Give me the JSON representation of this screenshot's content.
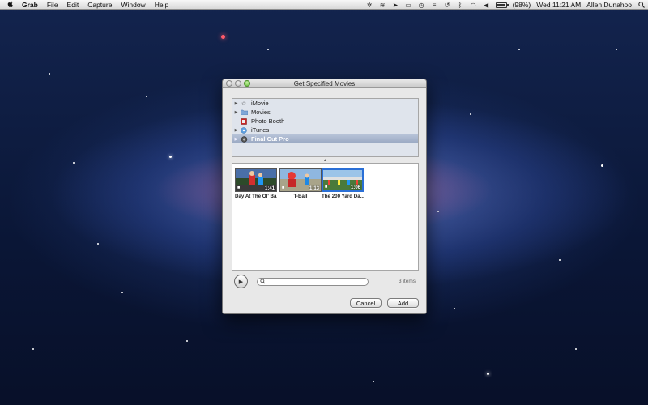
{
  "menubar": {
    "app_name": "Grab",
    "items": [
      "File",
      "Edit",
      "Capture",
      "Window",
      "Help"
    ],
    "battery_text": "(98%)",
    "battery_level": 0.98,
    "datetime": "Wed 11:21 AM",
    "user": "Allen Dunahoo"
  },
  "dialog": {
    "title": "Get Specified Movies",
    "sources": [
      {
        "label": "iMovie",
        "icon": "star-icon",
        "expandable": true
      },
      {
        "label": "Movies",
        "icon": "folder-icon",
        "expandable": true
      },
      {
        "label": "Photo Booth",
        "icon": "photo-booth-icon",
        "expandable": false
      },
      {
        "label": "iTunes",
        "icon": "itunes-icon",
        "expandable": true
      },
      {
        "label": "Final Cut Pro",
        "icon": "final-cut-icon",
        "expandable": true,
        "selected": true
      }
    ],
    "movies": [
      {
        "caption": "Day At The Ol' Ba...",
        "duration": "1:41"
      },
      {
        "caption": "T-Ball",
        "duration": "1:13"
      },
      {
        "caption": "The 200 Yard Da...",
        "duration": "1:06"
      }
    ],
    "search_value": "",
    "item_count": "3 items",
    "cancel_label": "Cancel",
    "add_label": "Add"
  },
  "colors": {
    "selection": "#2a6fd6",
    "source_selected": "#a3b1c8"
  }
}
